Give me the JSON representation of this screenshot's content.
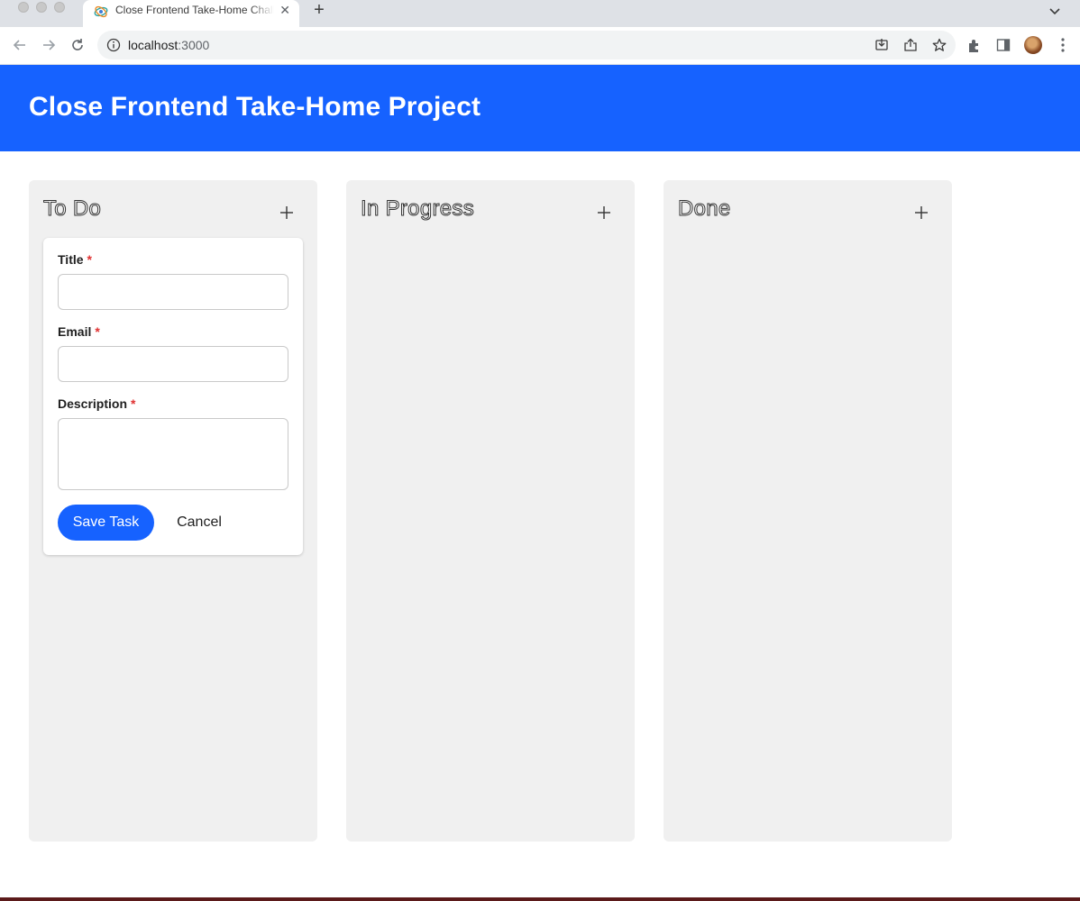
{
  "browser": {
    "tab_title": "Close Frontend Take-Home Challenge",
    "new_tab_label": "+",
    "url_host": "localhost",
    "url_port": ":3000"
  },
  "app": {
    "title": "Close Frontend Take-Home Project",
    "accent_color": "#1662ff",
    "required_color": "#e03131"
  },
  "columns": [
    {
      "title": "To Do",
      "add_icon": "plus-icon"
    },
    {
      "title": "In Progress",
      "add_icon": "plus-icon"
    },
    {
      "title": "Done",
      "add_icon": "plus-icon"
    }
  ],
  "form": {
    "title_label": "Title",
    "email_label": "Email",
    "description_label": "Description",
    "required_marker": "*",
    "title_value": "",
    "email_value": "",
    "description_value": "",
    "save_label": "Save Task",
    "cancel_label": "Cancel"
  }
}
